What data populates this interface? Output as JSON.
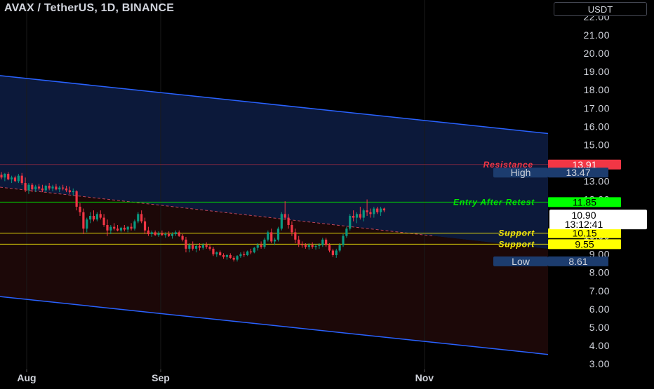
{
  "header": {
    "title": "AVAX / TetherUS, 1D, BINANCE",
    "currency": "USDT"
  },
  "chart_data": {
    "type": "candlestick",
    "symbol": "AVAX / TetherUS",
    "interval": "1D",
    "exchange": "BINANCE",
    "y_ticks": [
      3,
      4,
      5,
      6,
      7,
      8,
      9,
      10,
      11,
      12,
      13,
      14,
      15,
      16,
      17,
      18,
      19,
      20,
      21,
      22
    ],
    "ylim": [
      2.6,
      22.4
    ],
    "x_ticks": [
      "Aug",
      "Sep",
      "Nov"
    ],
    "channel": {
      "upper": [
        {
          "date": "2024-07-21",
          "value": 18.9
        },
        {
          "date": "2024-11-06",
          "value": 16.2
        }
      ],
      "lower": [
        {
          "date": "2024-07-21",
          "value": 6.8
        },
        {
          "date": "2024-11-06",
          "value": 4.1
        }
      ]
    },
    "trendline": [
      {
        "date": "2024-07-21",
        "value": 12.8
      },
      {
        "date": "2024-11-03",
        "value": 10.0
      }
    ],
    "levels": [
      {
        "label": "Resistance",
        "value": 13.91,
        "value_text": "13.91",
        "color": "#f23645"
      },
      {
        "label": "Entry After Retest",
        "value": 11.85,
        "value_text": "11.85",
        "color": "#00e600"
      },
      {
        "label": "Support",
        "value": 10.15,
        "value_text": "10.15",
        "color": "#f5e90a"
      },
      {
        "label": "Support",
        "value": 9.55,
        "value_text": "9.55",
        "color": "#f5e90a"
      }
    ],
    "high": {
      "label": "High",
      "value_text": "13.47",
      "value": 13.47
    },
    "low": {
      "label": "Low",
      "value_text": "8.61",
      "value": 8.61
    },
    "last_price": {
      "value": 10.9,
      "value_text": "10.90",
      "countdown": "13:12:41"
    },
    "candles": [
      {
        "o": 13.35,
        "h": 13.5,
        "l": 13.1,
        "c": 13.2
      },
      {
        "o": 13.2,
        "h": 13.45,
        "l": 13.0,
        "c": 13.4
      },
      {
        "o": 13.4,
        "h": 13.5,
        "l": 13.05,
        "c": 13.1
      },
      {
        "o": 13.1,
        "h": 13.3,
        "l": 12.9,
        "c": 13.2
      },
      {
        "o": 13.2,
        "h": 13.3,
        "l": 12.95,
        "c": 13.0
      },
      {
        "o": 13.0,
        "h": 13.4,
        "l": 12.9,
        "c": 13.3
      },
      {
        "o": 13.3,
        "h": 13.45,
        "l": 12.8,
        "c": 12.9
      },
      {
        "o": 12.9,
        "h": 13.2,
        "l": 12.4,
        "c": 12.5
      },
      {
        "o": 12.5,
        "h": 12.9,
        "l": 12.3,
        "c": 12.8
      },
      {
        "o": 12.8,
        "h": 12.9,
        "l": 12.4,
        "c": 12.55
      },
      {
        "o": 12.55,
        "h": 12.8,
        "l": 12.4,
        "c": 12.7
      },
      {
        "o": 12.7,
        "h": 12.85,
        "l": 12.5,
        "c": 12.6
      },
      {
        "o": 12.6,
        "h": 12.8,
        "l": 12.4,
        "c": 12.5
      },
      {
        "o": 12.5,
        "h": 12.8,
        "l": 12.4,
        "c": 12.75
      },
      {
        "o": 12.75,
        "h": 12.9,
        "l": 12.5,
        "c": 12.6
      },
      {
        "o": 12.6,
        "h": 12.8,
        "l": 12.45,
        "c": 12.7
      },
      {
        "o": 12.7,
        "h": 12.85,
        "l": 12.5,
        "c": 12.55
      },
      {
        "o": 12.55,
        "h": 12.75,
        "l": 12.4,
        "c": 12.65
      },
      {
        "o": 12.65,
        "h": 12.8,
        "l": 12.5,
        "c": 12.6
      },
      {
        "o": 12.6,
        "h": 12.75,
        "l": 12.4,
        "c": 12.5
      },
      {
        "o": 12.5,
        "h": 12.7,
        "l": 12.3,
        "c": 12.4
      },
      {
        "o": 12.4,
        "h": 12.6,
        "l": 12.2,
        "c": 12.45
      },
      {
        "o": 12.45,
        "h": 12.5,
        "l": 11.4,
        "c": 11.6
      },
      {
        "o": 11.6,
        "h": 11.8,
        "l": 11.1,
        "c": 11.3
      },
      {
        "o": 11.3,
        "h": 11.5,
        "l": 10.1,
        "c": 10.4
      },
      {
        "o": 10.4,
        "h": 11.0,
        "l": 10.2,
        "c": 10.9
      },
      {
        "o": 10.9,
        "h": 11.3,
        "l": 10.7,
        "c": 11.1
      },
      {
        "o": 11.1,
        "h": 11.4,
        "l": 10.8,
        "c": 10.9
      },
      {
        "o": 10.9,
        "h": 11.3,
        "l": 10.8,
        "c": 11.2
      },
      {
        "o": 11.2,
        "h": 11.4,
        "l": 10.9,
        "c": 11.0
      },
      {
        "o": 11.0,
        "h": 11.2,
        "l": 10.5,
        "c": 10.6
      },
      {
        "o": 10.6,
        "h": 10.9,
        "l": 10.0,
        "c": 10.3
      },
      {
        "o": 10.3,
        "h": 10.6,
        "l": 10.1,
        "c": 10.5
      },
      {
        "o": 10.5,
        "h": 10.7,
        "l": 10.3,
        "c": 10.4
      },
      {
        "o": 10.4,
        "h": 10.6,
        "l": 10.25,
        "c": 10.3
      },
      {
        "o": 10.3,
        "h": 10.5,
        "l": 10.2,
        "c": 10.45
      },
      {
        "o": 10.45,
        "h": 10.6,
        "l": 10.25,
        "c": 10.35
      },
      {
        "o": 10.35,
        "h": 10.55,
        "l": 10.2,
        "c": 10.5
      },
      {
        "o": 10.5,
        "h": 10.7,
        "l": 10.3,
        "c": 10.4
      },
      {
        "o": 10.4,
        "h": 10.9,
        "l": 10.3,
        "c": 10.8
      },
      {
        "o": 10.8,
        "h": 11.3,
        "l": 10.7,
        "c": 11.2
      },
      {
        "o": 11.2,
        "h": 11.4,
        "l": 10.7,
        "c": 10.8
      },
      {
        "o": 10.8,
        "h": 11.0,
        "l": 10.1,
        "c": 10.3
      },
      {
        "o": 10.3,
        "h": 10.5,
        "l": 10.0,
        "c": 10.1
      },
      {
        "o": 10.1,
        "h": 10.3,
        "l": 9.95,
        "c": 10.2
      },
      {
        "o": 10.2,
        "h": 10.3,
        "l": 10.0,
        "c": 10.05
      },
      {
        "o": 10.05,
        "h": 10.25,
        "l": 9.95,
        "c": 10.15
      },
      {
        "o": 10.15,
        "h": 10.3,
        "l": 10.0,
        "c": 10.05
      },
      {
        "o": 10.05,
        "h": 10.2,
        "l": 9.9,
        "c": 10.1
      },
      {
        "o": 10.1,
        "h": 10.25,
        "l": 9.95,
        "c": 10.0
      },
      {
        "o": 10.0,
        "h": 10.2,
        "l": 9.85,
        "c": 10.1
      },
      {
        "o": 10.1,
        "h": 10.3,
        "l": 10.0,
        "c": 10.2
      },
      {
        "o": 10.2,
        "h": 10.3,
        "l": 9.95,
        "c": 10.0
      },
      {
        "o": 10.0,
        "h": 10.1,
        "l": 9.7,
        "c": 9.8
      },
      {
        "o": 9.8,
        "h": 9.95,
        "l": 9.1,
        "c": 9.3
      },
      {
        "o": 9.3,
        "h": 9.6,
        "l": 9.1,
        "c": 9.5
      },
      {
        "o": 9.5,
        "h": 9.7,
        "l": 9.2,
        "c": 9.3
      },
      {
        "o": 9.3,
        "h": 9.55,
        "l": 9.1,
        "c": 9.45
      },
      {
        "o": 9.45,
        "h": 9.6,
        "l": 9.2,
        "c": 9.35
      },
      {
        "o": 9.35,
        "h": 9.6,
        "l": 9.25,
        "c": 9.5
      },
      {
        "o": 9.5,
        "h": 9.65,
        "l": 9.3,
        "c": 9.4
      },
      {
        "o": 9.4,
        "h": 9.5,
        "l": 9.2,
        "c": 9.3
      },
      {
        "o": 9.3,
        "h": 9.4,
        "l": 8.9,
        "c": 9.0
      },
      {
        "o": 9.0,
        "h": 9.15,
        "l": 8.85,
        "c": 9.1
      },
      {
        "o": 9.1,
        "h": 9.2,
        "l": 8.9,
        "c": 8.95
      },
      {
        "o": 8.95,
        "h": 9.05,
        "l": 8.75,
        "c": 8.85
      },
      {
        "o": 8.85,
        "h": 9.0,
        "l": 8.7,
        "c": 8.95
      },
      {
        "o": 8.95,
        "h": 9.05,
        "l": 8.75,
        "c": 8.8
      },
      {
        "o": 8.8,
        "h": 8.9,
        "l": 8.6,
        "c": 8.7
      },
      {
        "o": 8.7,
        "h": 8.95,
        "l": 8.6,
        "c": 8.9
      },
      {
        "o": 8.9,
        "h": 9.1,
        "l": 8.8,
        "c": 9.0
      },
      {
        "o": 9.0,
        "h": 9.15,
        "l": 8.85,
        "c": 8.95
      },
      {
        "o": 8.95,
        "h": 9.2,
        "l": 8.9,
        "c": 9.15
      },
      {
        "o": 9.15,
        "h": 9.3,
        "l": 9.0,
        "c": 9.1
      },
      {
        "o": 9.1,
        "h": 9.4,
        "l": 9.05,
        "c": 9.35
      },
      {
        "o": 9.35,
        "h": 9.6,
        "l": 9.2,
        "c": 9.5
      },
      {
        "o": 9.5,
        "h": 9.7,
        "l": 9.3,
        "c": 9.4
      },
      {
        "o": 9.4,
        "h": 9.9,
        "l": 9.3,
        "c": 9.8
      },
      {
        "o": 9.8,
        "h": 10.3,
        "l": 9.7,
        "c": 10.2
      },
      {
        "o": 10.2,
        "h": 10.4,
        "l": 9.6,
        "c": 9.7
      },
      {
        "o": 9.7,
        "h": 9.9,
        "l": 9.5,
        "c": 9.8
      },
      {
        "o": 9.8,
        "h": 10.5,
        "l": 9.7,
        "c": 10.4
      },
      {
        "o": 10.4,
        "h": 11.3,
        "l": 10.3,
        "c": 11.2
      },
      {
        "o": 11.2,
        "h": 11.9,
        "l": 10.9,
        "c": 11.0
      },
      {
        "o": 11.0,
        "h": 11.2,
        "l": 10.4,
        "c": 10.6
      },
      {
        "o": 10.6,
        "h": 10.8,
        "l": 10.0,
        "c": 10.2
      },
      {
        "o": 10.2,
        "h": 10.4,
        "l": 9.6,
        "c": 9.8
      },
      {
        "o": 9.8,
        "h": 10.0,
        "l": 9.4,
        "c": 9.55
      },
      {
        "o": 9.55,
        "h": 9.7,
        "l": 9.35,
        "c": 9.5
      },
      {
        "o": 9.5,
        "h": 9.6,
        "l": 9.3,
        "c": 9.4
      },
      {
        "o": 9.4,
        "h": 9.6,
        "l": 9.25,
        "c": 9.5
      },
      {
        "o": 9.5,
        "h": 9.65,
        "l": 9.3,
        "c": 9.4
      },
      {
        "o": 9.4,
        "h": 9.55,
        "l": 9.25,
        "c": 9.45
      },
      {
        "o": 9.45,
        "h": 9.6,
        "l": 9.3,
        "c": 9.5
      },
      {
        "o": 9.5,
        "h": 9.9,
        "l": 9.4,
        "c": 9.8
      },
      {
        "o": 9.8,
        "h": 9.9,
        "l": 9.4,
        "c": 9.5
      },
      {
        "o": 9.5,
        "h": 9.6,
        "l": 9.1,
        "c": 9.2
      },
      {
        "o": 9.2,
        "h": 9.3,
        "l": 8.85,
        "c": 8.95
      },
      {
        "o": 8.95,
        "h": 9.3,
        "l": 8.8,
        "c": 9.2
      },
      {
        "o": 9.2,
        "h": 9.6,
        "l": 9.1,
        "c": 9.5
      },
      {
        "o": 9.5,
        "h": 10.1,
        "l": 9.4,
        "c": 10.0
      },
      {
        "o": 10.0,
        "h": 10.5,
        "l": 9.9,
        "c": 10.4
      },
      {
        "o": 10.4,
        "h": 11.2,
        "l": 10.3,
        "c": 11.1
      },
      {
        "o": 11.1,
        "h": 11.4,
        "l": 10.8,
        "c": 11.0
      },
      {
        "o": 11.0,
        "h": 11.3,
        "l": 10.7,
        "c": 11.2
      },
      {
        "o": 11.2,
        "h": 11.6,
        "l": 10.9,
        "c": 11.0
      },
      {
        "o": 11.0,
        "h": 11.5,
        "l": 10.8,
        "c": 11.4
      },
      {
        "o": 11.4,
        "h": 12.0,
        "l": 11.1,
        "c": 11.3
      },
      {
        "o": 11.3,
        "h": 11.5,
        "l": 11.0,
        "c": 11.2
      },
      {
        "o": 11.2,
        "h": 11.6,
        "l": 11.0,
        "c": 11.5
      },
      {
        "o": 11.5,
        "h": 11.6,
        "l": 11.2,
        "c": 11.3
      },
      {
        "o": 11.3,
        "h": 11.6,
        "l": 11.1,
        "c": 11.5
      },
      {
        "o": 11.5,
        "h": 11.55,
        "l": 11.3,
        "c": 11.4
      }
    ]
  }
}
